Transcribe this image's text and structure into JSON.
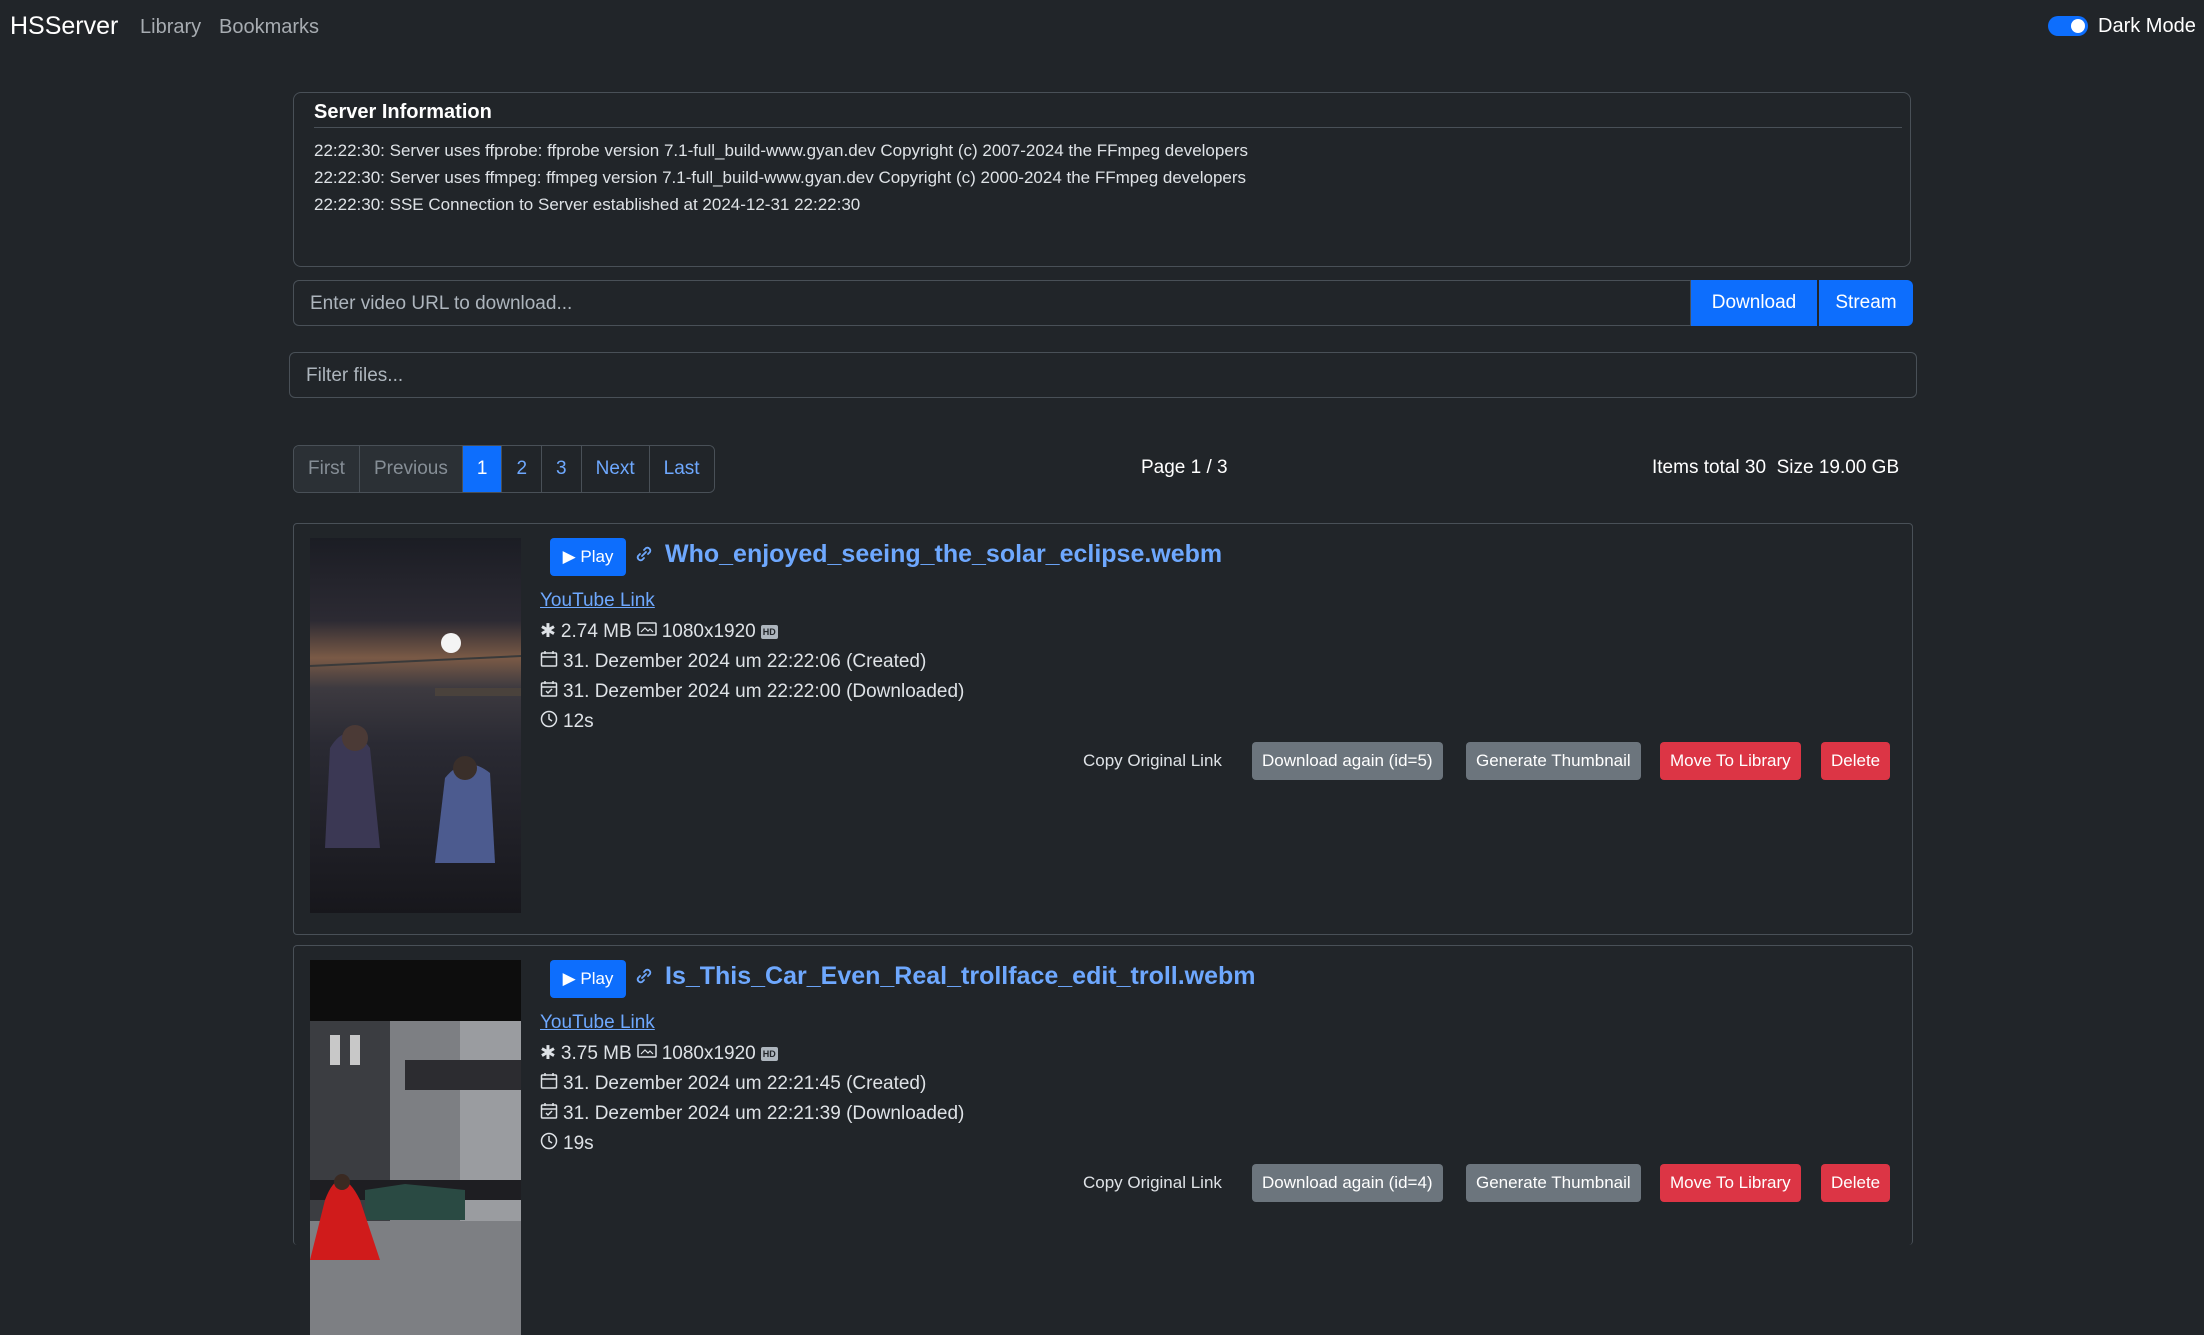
{
  "navbar": {
    "brand": "HSServer",
    "links": [
      "Library",
      "Bookmarks"
    ],
    "dark_mode_label": "Dark Mode",
    "dark_mode_on": true
  },
  "server_info": {
    "title": "Server Information",
    "logs": [
      "22:22:30: Server uses ffprobe: ffprobe version 7.1-full_build-www.gyan.dev Copyright (c) 2007-2024 the FFmpeg developers",
      "22:22:30: Server uses ffmpeg: ffmpeg version 7.1-full_build-www.gyan.dev Copyright (c) 2000-2024 the FFmpeg developers",
      "22:22:30: SSE Connection to Server established at 2024-12-31 22:22:30"
    ]
  },
  "url_input": {
    "placeholder": "Enter video URL to download...",
    "download_label": "Download",
    "stream_label": "Stream"
  },
  "filter": {
    "placeholder": "Filter files..."
  },
  "pagination": {
    "first": "First",
    "previous": "Previous",
    "pages": [
      "1",
      "2",
      "3"
    ],
    "next": "Next",
    "last": "Last",
    "status": "Page 1 / 3",
    "items_total": "Items total 30  Size 19.00 GB"
  },
  "videos": [
    {
      "play_label": "Play",
      "title": "Who_enjoyed_seeing_the_solar_eclipse.webm",
      "youtube_label": "YouTube Link",
      "size": "2.74 MB",
      "resolution": "1080x1920",
      "hd_badge": "HD",
      "created": "31. Dezember 2024 um 22:22:06 (Created)",
      "downloaded": "31. Dezember 2024 um 22:22:00 (Downloaded)",
      "duration": "12s",
      "copy_label": "Copy Original Link",
      "download_again_label": "Download again (id=5)",
      "generate_label": "Generate Thumbnail",
      "move_label": "Move To Library",
      "delete_label": "Delete"
    },
    {
      "play_label": "Play",
      "title": "Is_This_Car_Even_Real_trollface_edit_troll.webm",
      "youtube_label": "YouTube Link",
      "size": "3.75 MB",
      "resolution": "1080x1920",
      "hd_badge": "HD",
      "created": "31. Dezember 2024 um 22:21:45 (Created)",
      "downloaded": "31. Dezember 2024 um 22:21:39 (Downloaded)",
      "duration": "19s",
      "copy_label": "Copy Original Link",
      "download_again_label": "Download again (id=4)",
      "generate_label": "Generate Thumbnail",
      "move_label": "Move To Library",
      "delete_label": "Delete"
    }
  ]
}
